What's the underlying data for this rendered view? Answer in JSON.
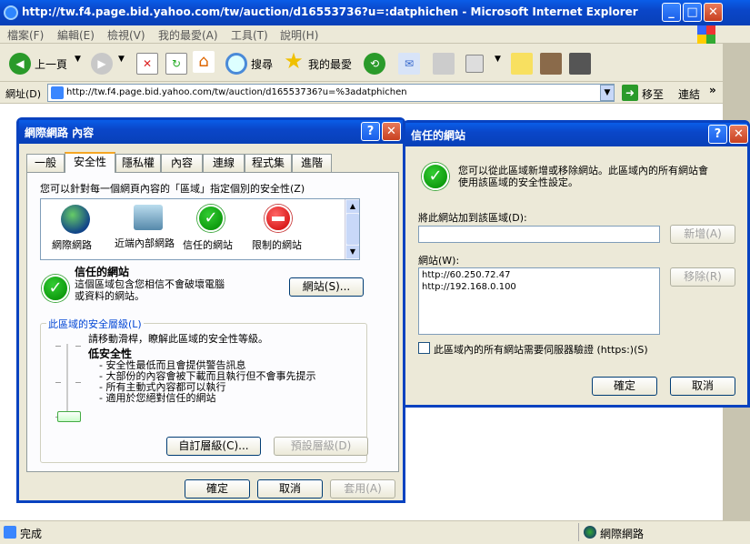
{
  "ie": {
    "title": "http://tw.f4.page.bid.yahoo.com/tw/auction/d16553736?u=:datphichen - Microsoft Internet Explorer",
    "menu": [
      "檔案(F)",
      "編輯(E)",
      "檢視(V)",
      "我的最愛(A)",
      "工具(T)",
      "說明(H)"
    ],
    "toolbar": {
      "back": "上一頁",
      "search": "搜尋",
      "favorites": "我的最愛"
    },
    "address_label": "網址(D)",
    "address": "http://tw.f4.page.bid.yahoo.com/tw/auction/d16553736?u=%3adatphichen",
    "go": "移至",
    "links": "連結",
    "status": "完成",
    "zone": "網際網路"
  },
  "inet": {
    "title": "網際網路 內容",
    "tabs": [
      "一般",
      "安全性",
      "隱私權",
      "內容",
      "連線",
      "程式集",
      "進階"
    ],
    "intro": "您可以針對每一個網頁內容的「區域」指定個別的安全性(Z)",
    "zones": [
      "網際網路",
      "近端內部網路",
      "信任的網站",
      "限制的網站"
    ],
    "zone_title": "信任的網站",
    "zone_desc1": "這個區域包含您相信不會破壞電腦",
    "zone_desc2": "或資料的網站。",
    "sites_btn": "網站(S)...",
    "level_group": "此區域的安全層級(L)",
    "slider_hint": "請移動滑桿，瞭解此區域的安全性等級。",
    "level_name": "低安全性",
    "level_items": [
      "- 安全性最低而且會提供警告訊息",
      "- 大部份的內容會被下載而且執行但不會事先提示",
      "- 所有主動式內容都可以執行",
      "- 適用於您絕對信任的網站"
    ],
    "custom_btn": "自訂層級(C)...",
    "default_btn": "預設層級(D)",
    "ok": "確定",
    "cancel": "取消",
    "apply": "套用(A)",
    "slider_level": 0
  },
  "trusted": {
    "title": "信任的網站",
    "desc1": "您可以從此區域新增或移除網站。此區域內的所有網站會",
    "desc2": "使用該區域的安全性設定。",
    "add_label": "將此網站加到該區域(D):",
    "add_value": "",
    "add_btn": "新增(A)",
    "sites_label": "網站(W):",
    "sites": [
      "http://60.250.72.47",
      "http://192.168.0.100"
    ],
    "remove_btn": "移除(R)",
    "https_label": "此區域內的所有網站需要伺服器驗證 (https:)(S)",
    "ok": "確定",
    "cancel": "取消"
  },
  "colors": {
    "titlebar": "#0a50d8",
    "face": "#ece9d8"
  }
}
